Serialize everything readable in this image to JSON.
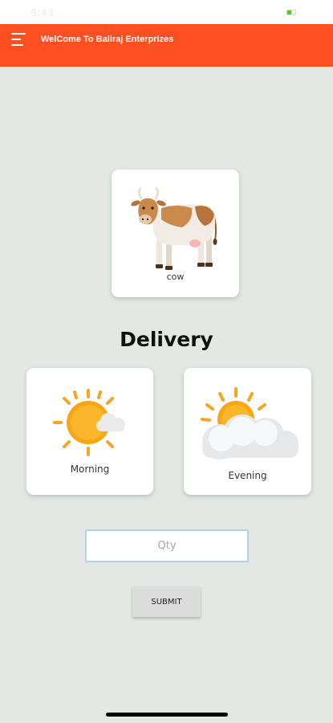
{
  "status_bar": {
    "time": "9:41",
    "battery_level": 0.45,
    "battery_color": "#5bc236"
  },
  "app_bar": {
    "title": "WelCome To Baliraj Enterprizes",
    "menu_icon": "hamburger-menu-icon",
    "background": "#fd4f21"
  },
  "product": {
    "label": "cow",
    "icon": "cow-icon"
  },
  "delivery": {
    "title": "Delivery",
    "options": [
      {
        "label": "Morning",
        "icon": "sun-partly-cloudy-icon"
      },
      {
        "label": "Evening",
        "icon": "sun-behind-clouds-icon"
      }
    ]
  },
  "form": {
    "qty_placeholder": "Qty",
    "qty_value": "",
    "submit_label": "SUBMIT"
  }
}
